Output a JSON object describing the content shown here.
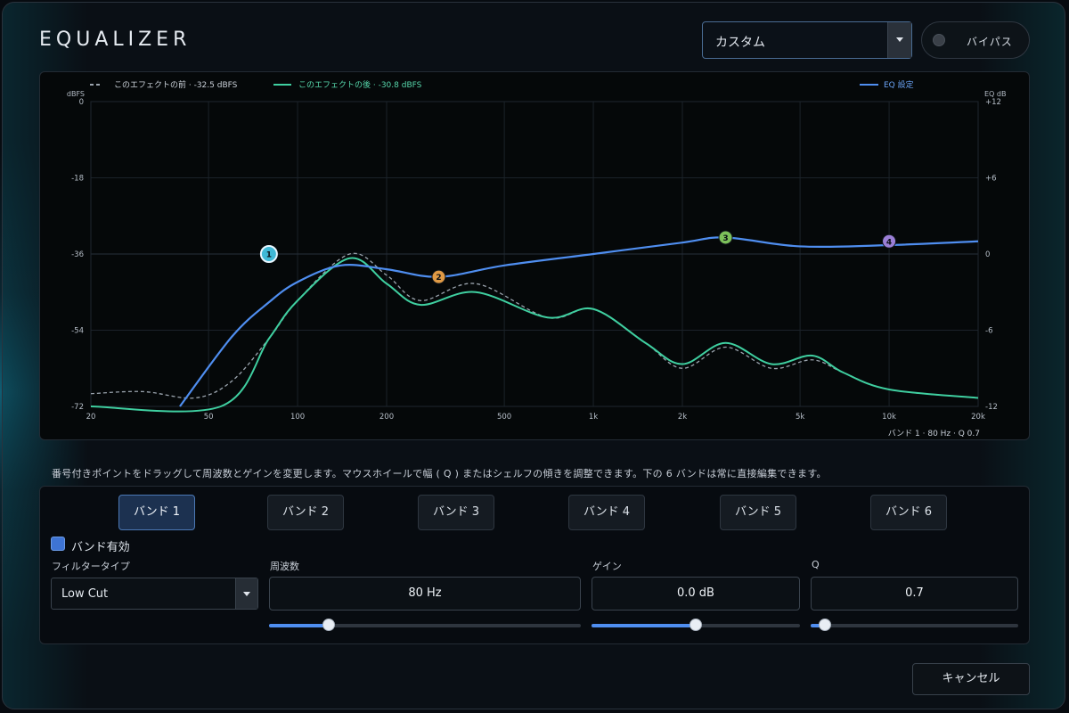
{
  "title": "EQUALIZER",
  "preset": {
    "selected": "カスタム"
  },
  "bypass": {
    "label": "バイパス",
    "on": false
  },
  "graph": {
    "legend": {
      "before": "このエフェクトの前 · -32.5 dBFS",
      "after": "このエフェクトの後 · -30.8 dBFS",
      "eq": "EQ 設定"
    },
    "left_axis_title": "dBFS",
    "right_axis_title": "EQ dB",
    "left_ticks": [
      "0",
      "-18",
      "-36",
      "-54",
      "-72"
    ],
    "right_ticks": [
      "+12",
      "+6",
      "0",
      "-6",
      "-12"
    ],
    "freq_ticks": [
      "20",
      "50",
      "100",
      "200",
      "500",
      "1k",
      "2k",
      "5k",
      "10k",
      "20k"
    ],
    "readout": "バンド 1 · 80 Hz · Q 0.7",
    "colors": {
      "eq": "#4f8ef0",
      "after": "#3fcfa0",
      "before": "#9aa3ad"
    }
  },
  "chart_data": {
    "type": "line",
    "x_scale": "log",
    "xlim": [
      20,
      20000
    ],
    "ylim_left_dbfs": [
      -72,
      0
    ],
    "ylim_right_eq_db": [
      -12,
      12
    ],
    "grid": true,
    "legend_position": "top",
    "bands_on_curve": [
      {
        "id": "1",
        "freq": 80,
        "gain": 0.0,
        "color": "#3fb8d6"
      },
      {
        "id": "2",
        "freq": 300,
        "gain": -1.8,
        "color": "#e09a45"
      },
      {
        "id": "3",
        "freq": 2800,
        "gain": 1.3,
        "color": "#7cc05a"
      },
      {
        "id": "4",
        "freq": 10000,
        "gain": 1.0,
        "color": "#9b7fd6"
      }
    ],
    "series": [
      {
        "name": "EQ 設定",
        "axis": "right",
        "x": [
          40,
          60,
          80,
          100,
          140,
          200,
          300,
          500,
          1000,
          2000,
          2800,
          5000,
          10000,
          20000
        ],
        "y": [
          -12,
          -6.5,
          -3.8,
          -2.2,
          -0.9,
          -1.2,
          -1.8,
          -0.9,
          0.0,
          0.9,
          1.3,
          0.6,
          0.7,
          1.0
        ]
      },
      {
        "name": "このエフェクトの後",
        "axis": "left",
        "x": [
          20,
          55,
          80,
          100,
          150,
          200,
          260,
          400,
          700,
          1000,
          1500,
          2000,
          2800,
          4000,
          5500,
          7000,
          10000,
          20000
        ],
        "y": [
          -72,
          -72,
          -56,
          -47,
          -37,
          -43,
          -48,
          -45,
          -51,
          -49,
          -57,
          -62,
          -57,
          -62,
          -60,
          -64,
          -68,
          -70
        ]
      },
      {
        "name": "このエフェクトの前",
        "axis": "left",
        "x": [
          20,
          30,
          45,
          60,
          80,
          100,
          150,
          200,
          260,
          400,
          700,
          1000,
          1500,
          2000,
          2800,
          4000,
          5500,
          7000,
          10000,
          20000
        ],
        "y": [
          -69,
          -68.5,
          -70,
          -66,
          -56,
          -47,
          -36,
          -41,
          -47,
          -43,
          -51,
          -49,
          -57,
          -63,
          -58,
          -63,
          -61,
          -64,
          -68,
          -70
        ]
      }
    ]
  },
  "hint": "番号付きポイントをドラッグして周波数とゲインを変更します。マウスホイールで幅 ( Q ) またはシェルフの傾きを調整できます。下の 6 バンドは常に直接編集できます。",
  "bands": [
    {
      "label": "バンド 1"
    },
    {
      "label": "バンド 2"
    },
    {
      "label": "バンド 3"
    },
    {
      "label": "バンド 4"
    },
    {
      "label": "バンド 5"
    },
    {
      "label": "バンド 6"
    }
  ],
  "editor": {
    "enabled_label": "バンド有効",
    "enabled": true,
    "filter_type_label": "フィルタータイプ",
    "filter_type": "Low Cut",
    "freq_label": "周波数",
    "freq_value": "80 Hz",
    "freq_slider": 0.19,
    "gain_label": "ゲイン",
    "gain_value": "0.0 dB",
    "gain_slider": 0.5,
    "q_label": "Q",
    "q_value": "0.7",
    "q_slider": 0.07
  },
  "cancel_label": "キャンセル"
}
